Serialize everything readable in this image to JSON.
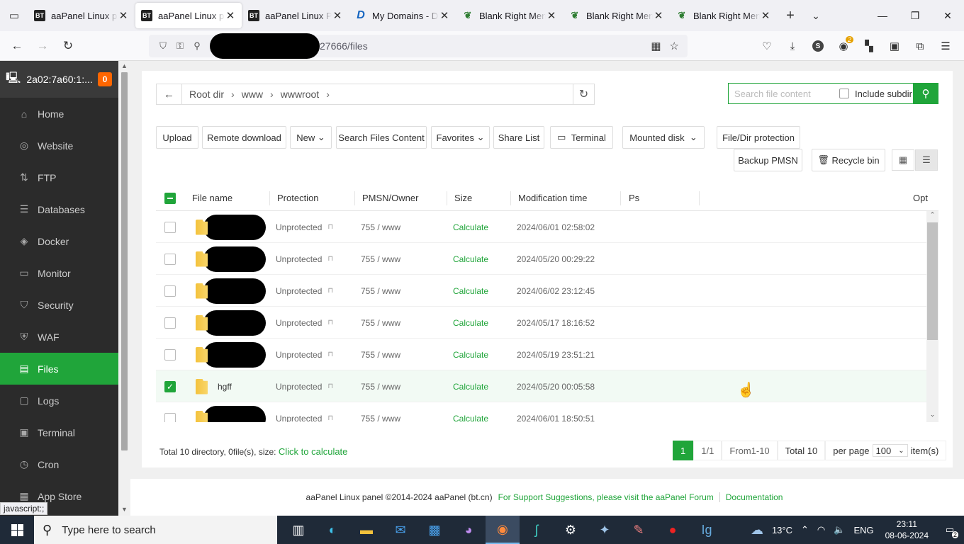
{
  "browser": {
    "tabs": [
      {
        "title": "aaPanel Linux panel",
        "icon": "bt-icon",
        "active": false
      },
      {
        "title": "aaPanel Linux panel",
        "icon": "bt-icon",
        "active": true
      },
      {
        "title": "aaPanel Linux Panel",
        "icon": "bt-icon",
        "active": false
      },
      {
        "title": "My Domains - DNS",
        "icon": "dns-icon",
        "active": false
      },
      {
        "title": "Blank Right Menu",
        "icon": "leaf-icon",
        "active": false
      },
      {
        "title": "Blank Right Menu",
        "icon": "leaf-icon",
        "active": false
      },
      {
        "title": "Blank Right Menu",
        "icon": "leaf-icon",
        "active": false
      }
    ],
    "url": "27666/files",
    "extension_badge": "2",
    "profile_letter": "S"
  },
  "sidebar": {
    "server": "2a02:7a60:1:...",
    "alert_count": "0",
    "items": [
      {
        "label": "Home",
        "icon": "home-icon",
        "glyph": "⌂"
      },
      {
        "label": "Website",
        "icon": "globe-icon",
        "glyph": "◎"
      },
      {
        "label": "FTP",
        "icon": "ftp-icon",
        "glyph": "⇅"
      },
      {
        "label": "Databases",
        "icon": "database-icon",
        "glyph": "☰"
      },
      {
        "label": "Docker",
        "icon": "docker-icon",
        "glyph": "◈"
      },
      {
        "label": "Monitor",
        "icon": "monitor-icon",
        "glyph": "▭"
      },
      {
        "label": "Security",
        "icon": "shield-icon",
        "glyph": "⛉"
      },
      {
        "label": "WAF",
        "icon": "waf-icon",
        "glyph": "⛨"
      },
      {
        "label": "Files",
        "icon": "folder-icon",
        "glyph": "▤",
        "active": true
      },
      {
        "label": "Logs",
        "icon": "logs-icon",
        "glyph": "▢"
      },
      {
        "label": "Terminal",
        "icon": "terminal-icon",
        "glyph": "▣"
      },
      {
        "label": "Cron",
        "icon": "clock-icon",
        "glyph": "◷"
      },
      {
        "label": "App Store",
        "icon": "apps-icon",
        "glyph": "▦"
      }
    ],
    "status_tip": "javascript:;"
  },
  "files": {
    "breadcrumb": [
      "Root dir",
      "www",
      "wwwroot"
    ],
    "search_placeholder": "Search file content",
    "include_subdir": "Include subdir",
    "toolbar": {
      "upload": "Upload",
      "remote_download": "Remote download",
      "new": "New",
      "search_files_content": "Search Files Content",
      "favorites": "Favorites",
      "share_list": "Share List",
      "terminal": "Terminal",
      "mounted_disk": "Mounted disk",
      "file_dir_protection": "File/Dir protection",
      "backup_pmsn": "Backup PMSN",
      "recycle_bin": "Recycle bin"
    },
    "columns": {
      "name": "File name",
      "protection": "Protection",
      "owner": "PMSN/Owner",
      "size": "Size",
      "mtime": "Modification time",
      "ps": "Ps",
      "opt": "Opt"
    },
    "rows": [
      {
        "name": "",
        "redacted": true,
        "protection": "Unprotected",
        "owner": "755 / www",
        "size": "Calculate",
        "mtime": "2024/06/01 02:58:02",
        "checked": false
      },
      {
        "name": "",
        "redacted": true,
        "protection": "Unprotected",
        "owner": "755 / www",
        "size": "Calculate",
        "mtime": "2024/05/20 00:29:22",
        "checked": false
      },
      {
        "name": "",
        "redacted": true,
        "protection": "Unprotected",
        "owner": "755 / www",
        "size": "Calculate",
        "mtime": "2024/06/02 23:12:45",
        "checked": false
      },
      {
        "name": "",
        "redacted": true,
        "protection": "Unprotected",
        "owner": "755 / www",
        "size": "Calculate",
        "mtime": "2024/05/17 18:16:52",
        "checked": false
      },
      {
        "name": "",
        "redacted": true,
        "protection": "Unprotected",
        "owner": "755 / www",
        "size": "Calculate",
        "mtime": "2024/05/19 23:51:21",
        "checked": false
      },
      {
        "name": "hgff",
        "redacted": false,
        "protection": "Unprotected",
        "owner": "755 / www",
        "size": "Calculate",
        "mtime": "2024/05/20 00:05:58",
        "checked": true
      },
      {
        "name": "",
        "redacted": true,
        "protection": "Unprotected",
        "owner": "755 / www",
        "size": "Calculate",
        "mtime": "2024/06/01 18:50:51",
        "checked": false
      }
    ],
    "summary": "Total 10 directory, 0file(s), size:",
    "summary_link": "Click to calculate",
    "pager": {
      "current": "1",
      "pages": "1/1",
      "range": "From1-10",
      "total": "Total 10",
      "per_page_label": "per page",
      "per_page": "100",
      "items": "item(s)"
    }
  },
  "footer": {
    "copyright": "aaPanel Linux panel ©2014-2024 aaPanel (bt.cn)",
    "support": "For Support Suggestions, please visit the aaPanel Forum",
    "docs": "Documentation"
  },
  "taskbar": {
    "search_placeholder": "Type here to search",
    "temperature": "13°C",
    "language": "ENG",
    "time": "23:11",
    "date": "08-06-2024",
    "notifications": "2"
  },
  "colors": {
    "accent": "#20a53a",
    "sidebar_bg": "#2b2b2b"
  }
}
